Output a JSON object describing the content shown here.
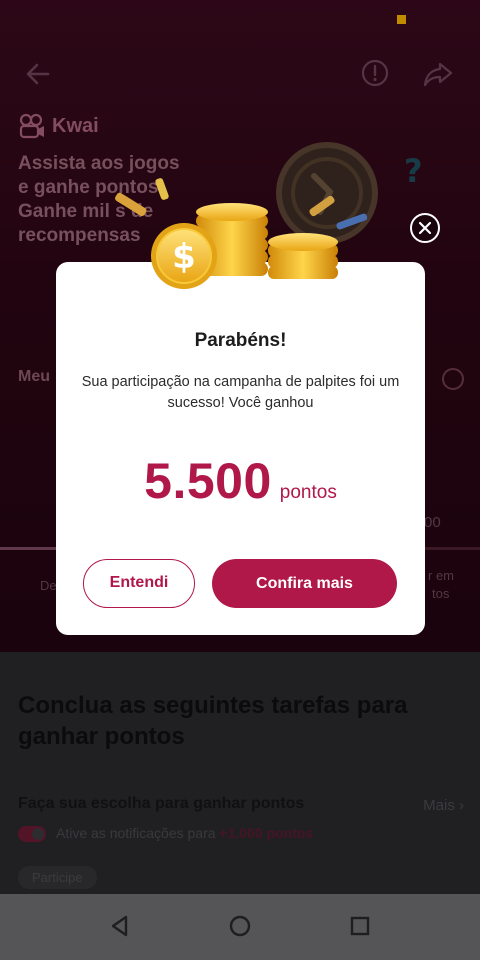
{
  "background": {
    "brand": "Kwai",
    "headline_lines": [
      "Assista aos jogos",
      "e ganhe pontos",
      "Ganhe mil   s de",
      "recompensas"
    ],
    "mid_label": "Meu",
    "fragments": {
      "left_de": "De",
      "right_amount": "00",
      "right_em": "r em",
      "right_tos": "tos"
    },
    "tasks_title": "Conclua as seguintes tarefas para ganhar pontos",
    "task": {
      "title": "Faça sua escolha para ganhar pontos",
      "more": "Mais",
      "desc_prefix": "Ative as notificações para",
      "desc_points": "+1.000 pontos",
      "chip": "Participe"
    }
  },
  "modal": {
    "title": "Parabéns!",
    "message": "Sua participação na campanha de palpites foi um sucesso! Você ganhou",
    "reward_amount": "5.500",
    "reward_unit": "pontos",
    "secondary_button": "Entendi",
    "primary_button": "Confira mais"
  },
  "icons": {
    "back": "arrow-left-icon",
    "info": "info-circle-icon",
    "share": "share-arrow-icon",
    "close": "close-icon",
    "nav_back": "triangle-back-icon",
    "nav_home": "circle-home-icon",
    "nav_recents": "square-recents-icon"
  },
  "colors": {
    "accent": "#b0184a",
    "background_dark": "#2b0614",
    "modal_bg": "#ffffff",
    "status_indicator": "#f6b400"
  }
}
